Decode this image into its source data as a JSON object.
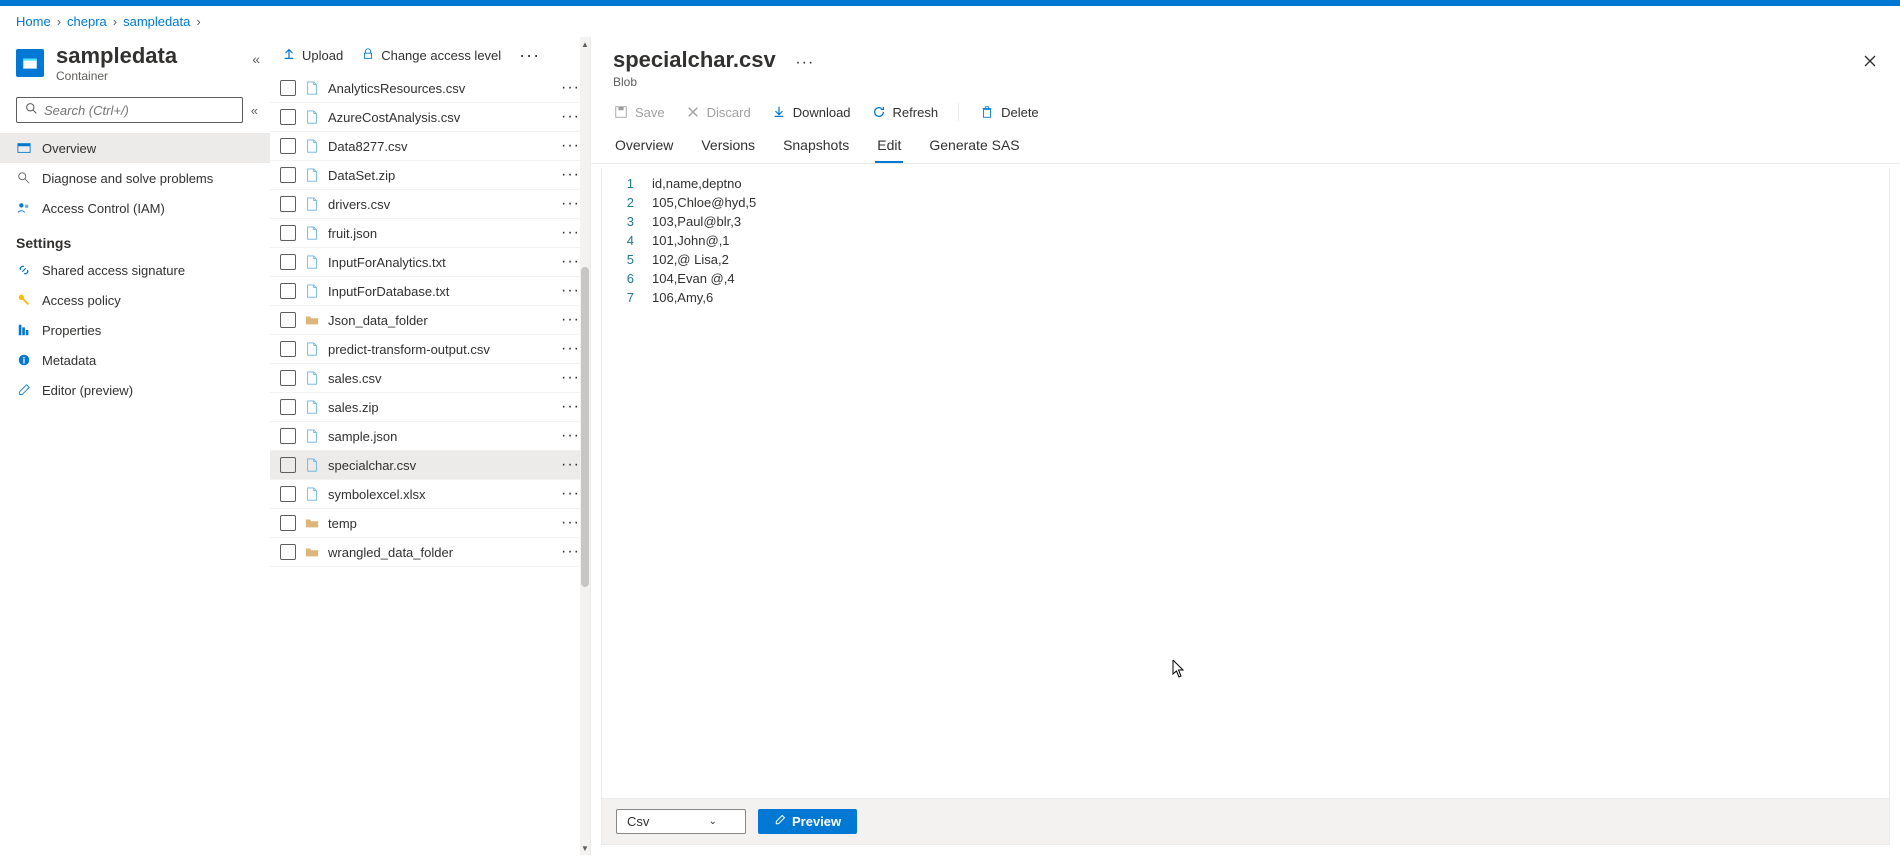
{
  "breadcrumb": {
    "items": [
      "Home",
      "chepra",
      "sampledata"
    ]
  },
  "container": {
    "title": "sampledata",
    "subtitle": "Container",
    "search_placeholder": "Search (Ctrl+/)"
  },
  "nav": {
    "overview": "Overview",
    "diagnose": "Diagnose and solve problems",
    "iam": "Access Control (IAM)",
    "settings_header": "Settings",
    "sas": "Shared access signature",
    "access_policy": "Access policy",
    "properties": "Properties",
    "metadata": "Metadata",
    "editor": "Editor (preview)"
  },
  "file_toolbar": {
    "upload": "Upload",
    "change_access": "Change access level"
  },
  "files": [
    {
      "name": "AnalyticsResources.csv",
      "type": "file"
    },
    {
      "name": "AzureCostAnalysis.csv",
      "type": "file"
    },
    {
      "name": "Data8277.csv",
      "type": "file"
    },
    {
      "name": "DataSet.zip",
      "type": "file"
    },
    {
      "name": "drivers.csv",
      "type": "file"
    },
    {
      "name": "fruit.json",
      "type": "file"
    },
    {
      "name": "InputForAnalytics.txt",
      "type": "file"
    },
    {
      "name": "InputForDatabase.txt",
      "type": "file"
    },
    {
      "name": "Json_data_folder",
      "type": "folder"
    },
    {
      "name": "predict-transform-output.csv",
      "type": "file"
    },
    {
      "name": "sales.csv",
      "type": "file"
    },
    {
      "name": "sales.zip",
      "type": "file"
    },
    {
      "name": "sample.json",
      "type": "file"
    },
    {
      "name": "specialchar.csv",
      "type": "file",
      "selected": true
    },
    {
      "name": "symbolexcel.xlsx",
      "type": "file"
    },
    {
      "name": "temp",
      "type": "folder"
    },
    {
      "name": "wrangled_data_folder",
      "type": "folder"
    }
  ],
  "detail": {
    "title": "specialchar.csv",
    "subtitle": "Blob",
    "toolbar": {
      "save": "Save",
      "discard": "Discard",
      "download": "Download",
      "refresh": "Refresh",
      "delete": "Delete"
    },
    "tabs": {
      "overview": "Overview",
      "versions": "Versions",
      "snapshots": "Snapshots",
      "edit": "Edit",
      "generate_sas": "Generate SAS"
    },
    "active_tab": "edit",
    "code_lines": [
      "id,name,deptno",
      "105,Chloe@hyd,5",
      "103,Paul@blr,3",
      "101,John@,1",
      "102,@ Lisa,2",
      "104,Evan @,4",
      "106,Amy,6"
    ],
    "footer": {
      "format": "Csv",
      "preview": "Preview"
    }
  }
}
